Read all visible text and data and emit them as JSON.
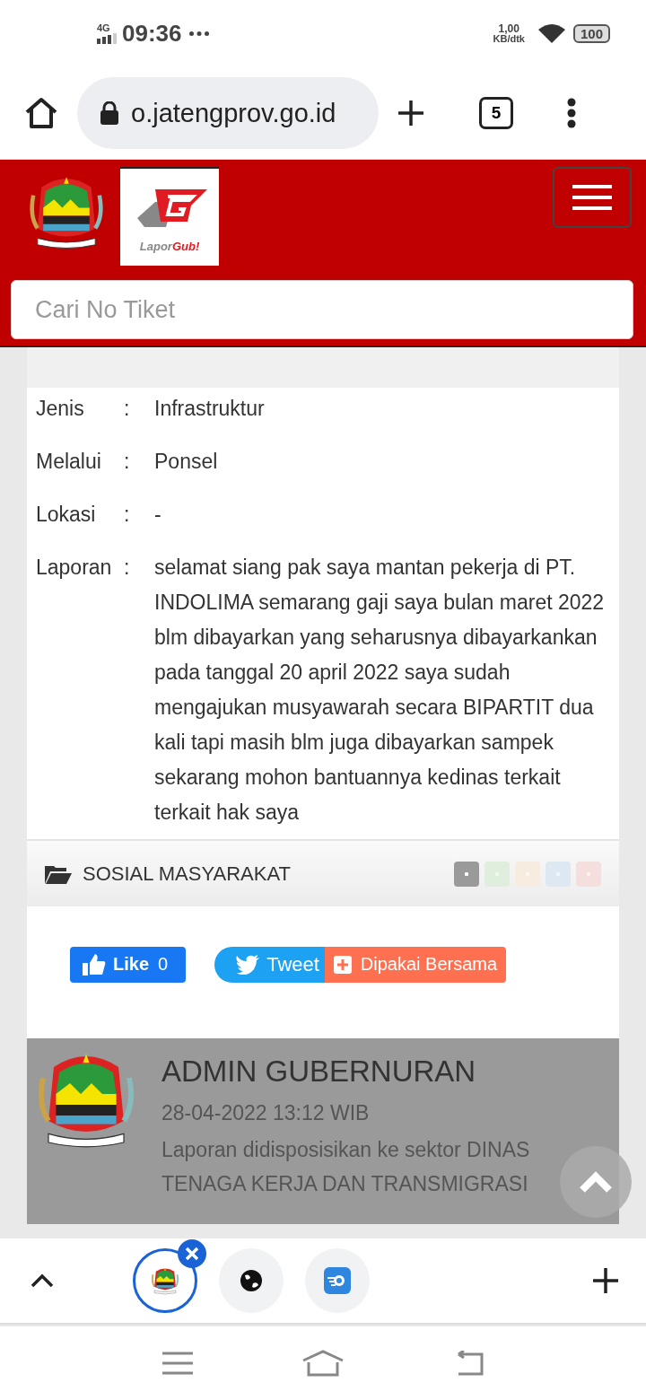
{
  "status_bar": {
    "network": "4G",
    "time": "09:36",
    "speed": "1,00",
    "speed_unit": "KB/dtk",
    "battery": "100"
  },
  "browser": {
    "url": "o.jatengprov.go.id",
    "tab_count": "5"
  },
  "header": {
    "logo_text": "Lapor",
    "logo_text_bold": "Gub!",
    "search": {
      "placeholder": "Cari No Tiket"
    }
  },
  "report": {
    "fields": [
      {
        "label": "Jenis",
        "separator": ":",
        "value": "Infrastruktur"
      },
      {
        "label": "Melalui",
        "separator": ":",
        "value": "Ponsel"
      },
      {
        "label": "Lokasi",
        "separator": ":",
        "value": "-"
      },
      {
        "label": "Laporan",
        "separator": ":",
        "value": "selamat siang pak saya mantan pekerja di PT. INDOLIMA semarang gaji saya bulan maret 2022 blm dibayarkan yang seharusnya dibayarkankan pada tanggal 20 april 2022 saya sudah mengajukan musyawarah secara BIPARTIT dua kali tapi masih blm juga dibayarkan sampek sekarang mohon bantuannya kedinas terkait terkait hak saya"
      }
    ],
    "category": "SOSIAL MASYARAKAT",
    "status_dots": [
      {
        "color": "#9a9a9a",
        "selected": true
      },
      {
        "color": "#dfeedd",
        "selected": false
      },
      {
        "color": "#f6ecdf",
        "selected": false
      },
      {
        "color": "#dde8f2",
        "selected": false
      },
      {
        "color": "#f4dede",
        "selected": false
      }
    ]
  },
  "share": {
    "like": "Like",
    "like_count": "0",
    "tweet": "Tweet",
    "share": "Dipakai Bersama"
  },
  "response": {
    "author": "ADMIN GUBERNURAN",
    "time": "28-04-2022 13:12 WIB",
    "message": "Laporan didisposisikan ke sektor DINAS TENAGA KERJA DAN TRANSMIGRASI"
  },
  "tab_strip": [
    {
      "kind": "emblem",
      "selected": true
    },
    {
      "kind": "globe",
      "selected": false
    },
    {
      "kind": "app",
      "selected": false
    }
  ]
}
